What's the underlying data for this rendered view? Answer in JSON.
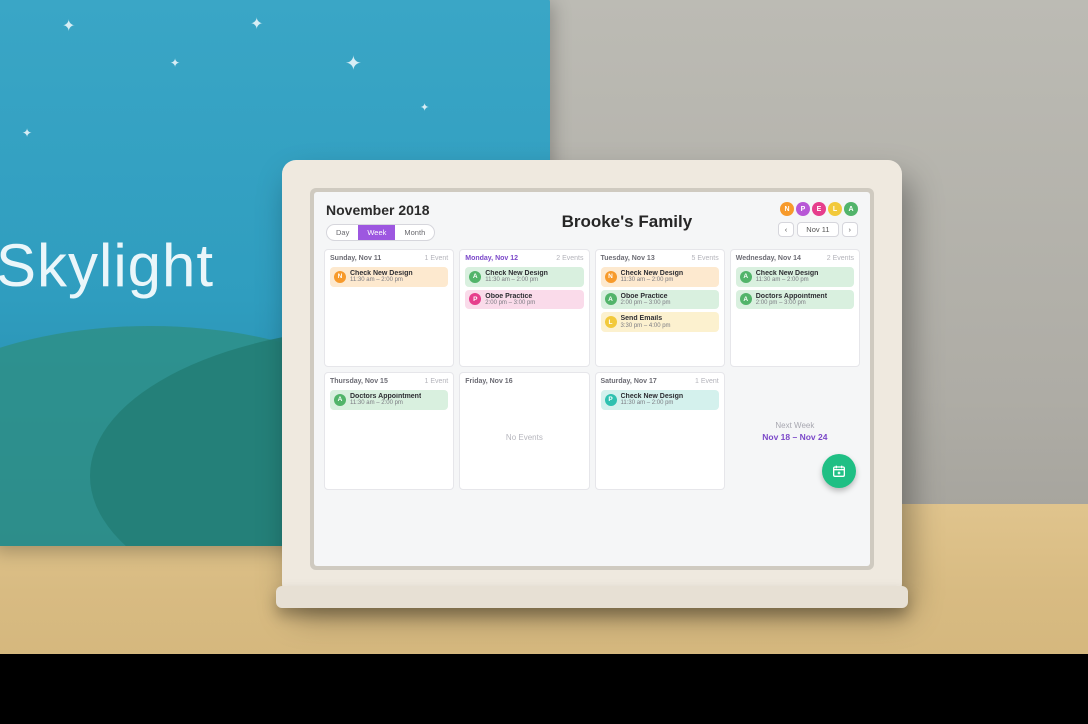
{
  "box_brand": "Skylight",
  "header": {
    "month": "November 2018",
    "family": "Brooke's Family",
    "views": {
      "day": "Day",
      "week": "Week",
      "month": "Month",
      "active": "week"
    },
    "nav_date": "Nov 11",
    "nav_prev": "‹",
    "nav_next": "›"
  },
  "avatars": [
    {
      "letter": "N",
      "color": "c-orange"
    },
    {
      "letter": "P",
      "color": "c-purple"
    },
    {
      "letter": "E",
      "color": "c-pink"
    },
    {
      "letter": "L",
      "color": "c-yellow"
    },
    {
      "letter": "A",
      "color": "c-green"
    }
  ],
  "days": [
    {
      "name": "Sunday, Nov 11",
      "count": "1 Event",
      "current": false,
      "events": [
        {
          "av": "N",
          "avc": "c-orange",
          "bg": "bg-orange",
          "title": "Check New Design",
          "time": "11:30 am – 2:00 pm"
        }
      ]
    },
    {
      "name": "Monday, Nov 12",
      "count": "2 Events",
      "current": true,
      "events": [
        {
          "av": "A",
          "avc": "c-green",
          "bg": "bg-green",
          "title": "Check New Design",
          "time": "11:30 am – 2:00 pm"
        },
        {
          "av": "P",
          "avc": "c-pink",
          "bg": "bg-pink",
          "title": "Oboe Practice",
          "time": "2:00 pm – 3:00 pm"
        }
      ]
    },
    {
      "name": "Tuesday, Nov 13",
      "count": "5 Events",
      "current": false,
      "events": [
        {
          "av": "N",
          "avc": "c-orange",
          "bg": "bg-orange",
          "title": "Check New Design",
          "time": "11:30 am – 2:00 pm"
        },
        {
          "av": "A",
          "avc": "c-green",
          "bg": "bg-green",
          "title": "Oboe Practice",
          "time": "2:00 pm – 3:00 pm"
        },
        {
          "av": "L",
          "avc": "c-yellow",
          "bg": "bg-yellow",
          "title": "Send Emails",
          "time": "3:30 pm – 4:00 pm"
        }
      ]
    },
    {
      "name": "Wednesday, Nov 14",
      "count": "2 Events",
      "current": false,
      "events": [
        {
          "av": "A",
          "avc": "c-green",
          "bg": "bg-green",
          "title": "Check New Design",
          "time": "11:30 am – 2:00 pm"
        },
        {
          "av": "A",
          "avc": "c-green",
          "bg": "bg-green",
          "title": "Doctors Appointment",
          "time": "2:00 pm – 3:00 pm"
        }
      ]
    },
    {
      "name": "Thursday, Nov 15",
      "count": "1 Event",
      "current": false,
      "events": [
        {
          "av": "A",
          "avc": "c-green",
          "bg": "bg-green",
          "title": "Doctors Appointment",
          "time": "11:30 am – 2:00 pm"
        }
      ]
    },
    {
      "name": "Friday, Nov 16",
      "count": "",
      "current": false,
      "empty_label": "No Events",
      "events": []
    },
    {
      "name": "Saturday, Nov 17",
      "count": "1 Event",
      "current": false,
      "events": [
        {
          "av": "P",
          "avc": "c-teal",
          "bg": "bg-teal",
          "title": "Check New Design",
          "time": "11:30 am – 2:00 pm"
        }
      ]
    }
  ],
  "next": {
    "label": "Next Week",
    "range": "Nov 18 – Nov 24"
  }
}
